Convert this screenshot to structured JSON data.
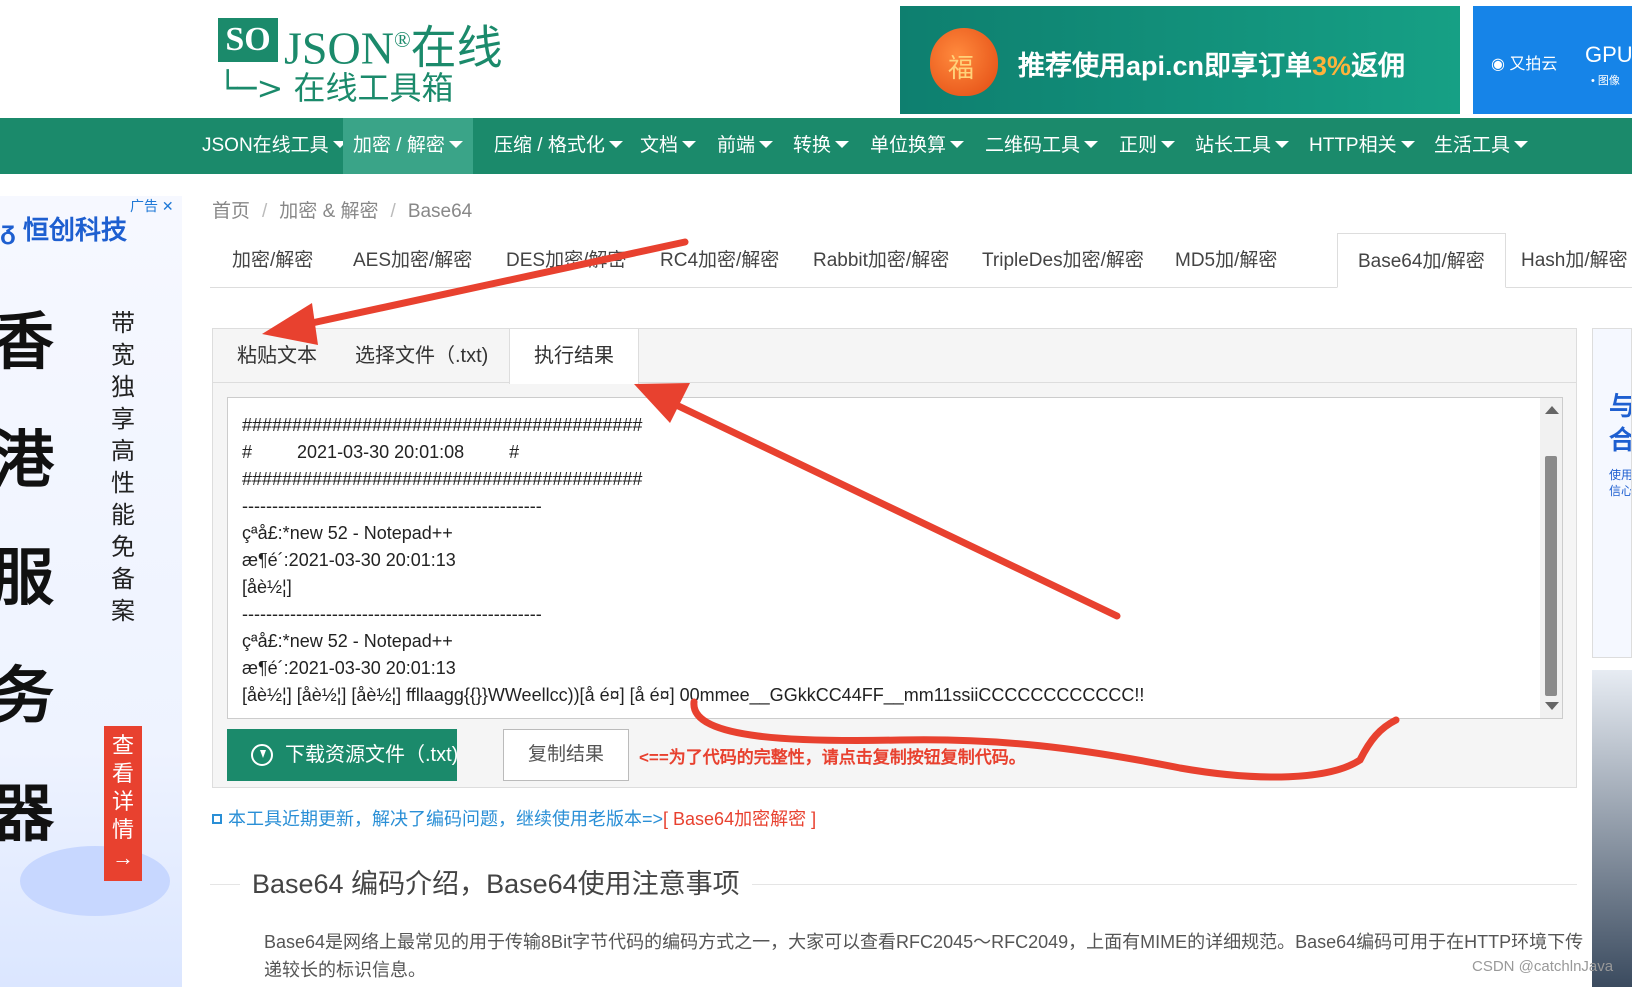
{
  "logo": {
    "so": "SO",
    "json": "JSON",
    "reg": "®",
    "zaixian": "在线",
    "subtitle": "在线工具箱"
  },
  "ad_banner": {
    "bag_char": "福",
    "text_pre": "推荐使用api.cn即享订单",
    "text_pct": "3%",
    "text_post": "返佣"
  },
  "ad_right": {
    "brand": "又拍云",
    "title": "GPU",
    "sub": "• 图像"
  },
  "nav": [
    "JSON在线工具",
    "加密 / 解密",
    "压缩 / 格式化",
    "文档",
    "前端",
    "转换",
    "单位换算",
    "二维码工具",
    "正则",
    "站长工具",
    "HTTP相关",
    "生活工具"
  ],
  "left_ad": {
    "tag": "广告 ✕",
    "brand": "ᵹ 恒创科技",
    "big": "香港服务器",
    "col": "带宽独享 高性能 免备案",
    "view": "查看详情 →"
  },
  "right_ad": {
    "title": "与合",
    "sub": "使用信心"
  },
  "breadcrumb": [
    "首页",
    "加密 & 解密",
    "Base64"
  ],
  "breadcrumb_sep": "/",
  "subtabs": [
    "加密/解密",
    "AES加密/解密",
    "DES加密/解密",
    "RC4加密/解密",
    "Rabbit加密/解密",
    "TripleDes加密/解密",
    "MD5加/解密",
    "Base64加/解密",
    "Hash加/解密"
  ],
  "panel_tabs": [
    "粘贴文本",
    "选择文件（.txt)",
    "执行结果"
  ],
  "output_lines": [
    "########################################",
    "#         2021-03-30 20:01:08         #",
    "########################################",
    "--------------------------------------------------",
    "çªå£:*new 52 - Notepad++",
    "æ¶é´:2021-03-30 20:01:13",
    "[åè½¦]",
    "--------------------------------------------------",
    "çªå£:*new 52 - Notepad++",
    "æ¶é´:2021-03-30 20:01:13",
    "[åè½¦] [åè½¦] [åè½¦] ffllaagg{{}}WWeellcc))[å é¤] [å é¤] 00mmee__GGkkCC44FF__mm11ssiiCCCCCCCCCCCC!!"
  ],
  "buttons": {
    "download": "下载资源文件（.txt)",
    "copy": "复制结果"
  },
  "copy_note": "<==为了代码的完整性，请点击复制按钮复制代码。",
  "notice": {
    "text": "本工具近期更新，解决了编码问题，继续使用老版本=>",
    "link": "[ Base64加密解密 ]"
  },
  "section_title": "Base64 编码介绍，Base64使用注意事项",
  "paragraph": "Base64是网络上最常见的用于传输8Bit字节代码的编码方式之一，大家可以查看RFC2045～RFC2049，上面有MIME的详细规范。Base64编码可用于在HTTP环境下传递较长的标识信息。",
  "watermark": "CSDN @catchlnJava",
  "colors": {
    "brand": "#1b8a6b",
    "annotation": "#e8412f",
    "link": "#2a8fd6"
  }
}
